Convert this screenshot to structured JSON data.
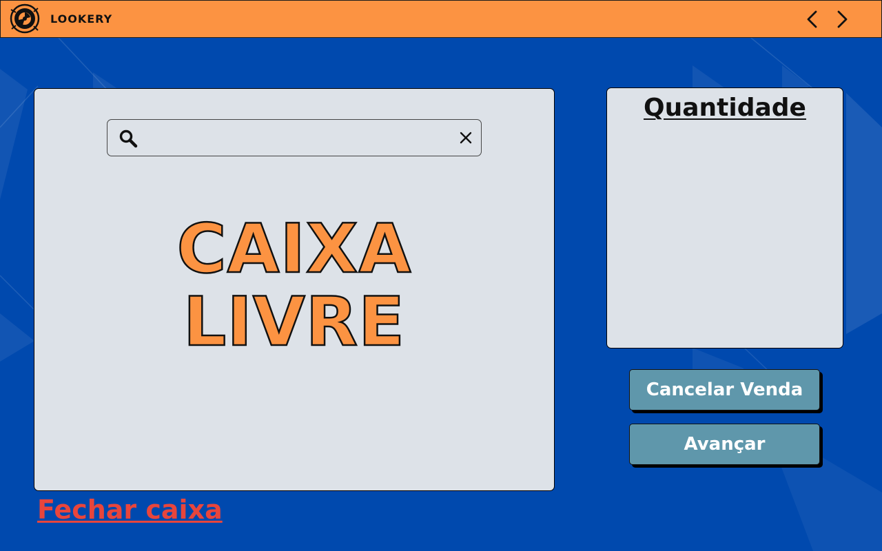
{
  "app": {
    "brand": "LOOKERY"
  },
  "header": {
    "back_icon": "chevron-left-icon",
    "forward_icon": "chevron-right-icon"
  },
  "search": {
    "value": "",
    "placeholder": "",
    "icon": "search-icon",
    "clear_icon": "close-icon"
  },
  "main": {
    "status_line1": "CAIXA",
    "status_line2": "LIVRE"
  },
  "quantity_panel": {
    "title": "Quantidade"
  },
  "actions": {
    "cancel_label": "Cancelar Venda",
    "next_label": "Avançar"
  },
  "footer": {
    "close_register_label": "Fechar caixa"
  },
  "colors": {
    "background": "#0049ae",
    "header": "#fc9342",
    "panel": "#dde2e8",
    "accent_text": "#fc9342",
    "button": "#5f97ab",
    "close_link": "#e8453c"
  }
}
